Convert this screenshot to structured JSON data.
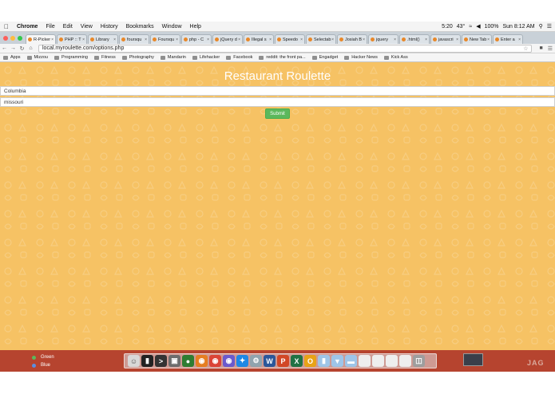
{
  "menubar": {
    "app_name": "Chrome",
    "menus": [
      "File",
      "Edit",
      "View",
      "History",
      "Bookmarks",
      "Window",
      "Help"
    ],
    "battery": "100%",
    "time_label": "5:20",
    "temperature": "43°",
    "datetime": "Sun 8:12 AM"
  },
  "tabs": [
    {
      "label": "R-Picker",
      "active": true
    },
    {
      "label": "PHP :: T"
    },
    {
      "label": "Library"
    },
    {
      "label": "foursqu"
    },
    {
      "label": "Foursqu"
    },
    {
      "label": "php - C"
    },
    {
      "label": "jQuery d"
    },
    {
      "label": "Illegal s"
    },
    {
      "label": "Speedo"
    },
    {
      "label": "Selectab"
    },
    {
      "label": "Josiah B"
    },
    {
      "label": "jquery"
    },
    {
      "label": ".html()"
    },
    {
      "label": "javascri"
    },
    {
      "label": "New Tab"
    },
    {
      "label": "Enter a"
    }
  ],
  "address_bar": {
    "url": "local.myroulette.com/options.php"
  },
  "bookmarks": [
    {
      "label": "Apps"
    },
    {
      "label": "Mizzou"
    },
    {
      "label": "Programming"
    },
    {
      "label": "Fitness"
    },
    {
      "label": "Photography"
    },
    {
      "label": "Mandarin"
    },
    {
      "label": "Lifehacker"
    },
    {
      "label": "Facebook"
    },
    {
      "label": "reddit: the front pa..."
    },
    {
      "label": "Engadget"
    },
    {
      "label": "Hacker News"
    },
    {
      "label": "Kick Ass"
    }
  ],
  "page": {
    "title": "Restaurant Roulette",
    "city_value": "Columbia",
    "state_value": "missouri",
    "submit_label": "Submit"
  },
  "desktop": {
    "labels": [
      {
        "label": "Green",
        "color": "#5cb85c"
      },
      {
        "label": "Blue",
        "color": "#5a8ee0"
      }
    ],
    "watermark": "JAG"
  },
  "colors": {
    "page_bg": "#f6c264",
    "submit_bg": "#5cb85c",
    "desktop_bg": "#b6442f"
  }
}
